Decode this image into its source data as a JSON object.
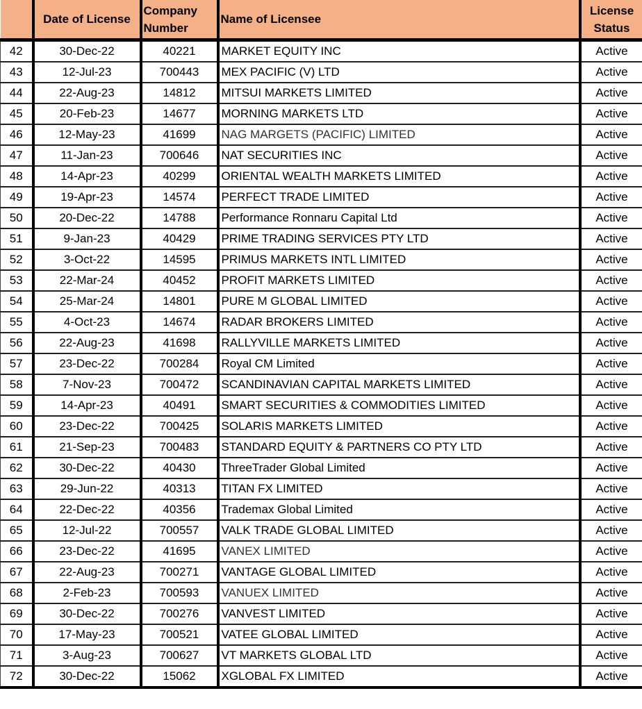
{
  "table": {
    "headers": [
      "",
      "Date of License",
      "Company Number",
      "Name of Licensee",
      "License Status"
    ],
    "header_color": "#f4b087",
    "rows": [
      {
        "no": "42",
        "date": "30-Dec-22",
        "company": "40221",
        "name": "MARKET EQUITY INC",
        "status": "Active"
      },
      {
        "no": "43",
        "date": "12-Jul-23",
        "company": "700443",
        "name": "MEX PACIFIC (V) LTD",
        "status": "Active"
      },
      {
        "no": "44",
        "date": "22-Aug-23",
        "company": "14812",
        "name": "MITSUI MARKETS LIMITED",
        "status": "Active"
      },
      {
        "no": "45",
        "date": "20-Feb-23",
        "company": "14677",
        "name": "MORNING MARKETS LTD",
        "status": "Active"
      },
      {
        "no": "46",
        "date": "12-May-23",
        "company": "41699",
        "name": "NAG MARGETS (PACIFIC) LIMITED",
        "status": "Active",
        "grey": true
      },
      {
        "no": "47",
        "date": "11-Jan-23",
        "company": "700646",
        "name": "NAT SECURITIES INC",
        "status": "Active"
      },
      {
        "no": "48",
        "date": "14-Apr-23",
        "company": "40299",
        "name": "ORIENTAL WEALTH MARKETS LIMITED",
        "status": "Active"
      },
      {
        "no": "49",
        "date": "19-Apr-23",
        "company": "14574",
        "name": "PERFECT TRADE LIMITED",
        "status": "Active"
      },
      {
        "no": "50",
        "date": "20-Dec-22",
        "company": "14788",
        "name": "Performance Ronnaru Capital Ltd",
        "status": "Active"
      },
      {
        "no": "51",
        "date": "9-Jan-23",
        "company": "40429",
        "name": "PRIME TRADING SERVICES PTY LTD",
        "status": "Active"
      },
      {
        "no": "52",
        "date": "3-Oct-22",
        "company": "14595",
        "name": "PRIMUS MARKETS INTL LIMITED",
        "status": "Active"
      },
      {
        "no": "53",
        "date": "22-Mar-24",
        "company": "40452",
        "name": "PROFIT MARKETS LIMITED",
        "status": "Active"
      },
      {
        "no": "54",
        "date": "25-Mar-24",
        "company": "14801",
        "name": "PURE M GLOBAL LIMITED",
        "status": "Active"
      },
      {
        "no": "55",
        "date": "4-Oct-23",
        "company": "14674",
        "name": "RADAR BROKERS LIMITED",
        "status": "Active"
      },
      {
        "no": "56",
        "date": "22-Aug-23",
        "company": "41698",
        "name": "RALLYVILLE MARKETS LIMITED",
        "status": "Active"
      },
      {
        "no": "57",
        "date": "23-Dec-22",
        "company": "700284",
        "name": "Royal CM Limited",
        "status": "Active"
      },
      {
        "no": "58",
        "date": "7-Nov-23",
        "company": "700472",
        "name": "SCANDINAVIAN CAPITAL MARKETS LIMITED",
        "status": "Active"
      },
      {
        "no": "59",
        "date": "14-Apr-23",
        "company": "40491",
        "name": "SMART SECURITIES & COMMODITIES LIMITED",
        "status": "Active"
      },
      {
        "no": "60",
        "date": "23-Dec-22",
        "company": "700425",
        "name": "SOLARIS MARKETS LIMITED",
        "status": "Active"
      },
      {
        "no": "61",
        "date": "21-Sep-23",
        "company": "700483",
        "name": "STANDARD EQUITY & PARTNERS CO PTY LTD",
        "status": "Active"
      },
      {
        "no": "62",
        "date": "30-Dec-22",
        "company": "40430",
        "name": "ThreeTrader Global Limited",
        "status": "Active"
      },
      {
        "no": "63",
        "date": "29-Jun-22",
        "company": "40313",
        "name": "TITAN FX LIMITED",
        "status": "Active"
      },
      {
        "no": "64",
        "date": "22-Dec-22",
        "company": "40356",
        "name": "Trademax Global Limited",
        "status": "Active"
      },
      {
        "no": "65",
        "date": "12-Jul-22",
        "company": "700557",
        "name": "VALK TRADE GLOBAL LIMITED",
        "status": "Active"
      },
      {
        "no": "66",
        "date": "23-Dec-22",
        "company": "41695",
        "name": "VANEX LIMITED",
        "status": "Active",
        "grey": true
      },
      {
        "no": "67",
        "date": "22-Aug-23",
        "company": "700271",
        "name": "VANTAGE GLOBAL LIMITED",
        "status": "Active"
      },
      {
        "no": "68",
        "date": "2-Feb-23",
        "company": "700593",
        "name": "VANUEX LIMITED",
        "status": "Active",
        "grey": true
      },
      {
        "no": "69",
        "date": "30-Dec-22",
        "company": "700276",
        "name": "VANVEST LIMITED",
        "status": "Active"
      },
      {
        "no": "70",
        "date": "17-May-23",
        "company": "700521",
        "name": "VATEE GLOBAL LIMITED",
        "status": "Active"
      },
      {
        "no": "71",
        "date": "3-Aug-23",
        "company": "700627",
        "name": "VT MARKETS GLOBAL LTD",
        "status": "Active"
      },
      {
        "no": "72",
        "date": "30-Dec-22",
        "company": "15062",
        "name": "XGLOBAL FX LIMITED",
        "status": "Active"
      }
    ]
  }
}
